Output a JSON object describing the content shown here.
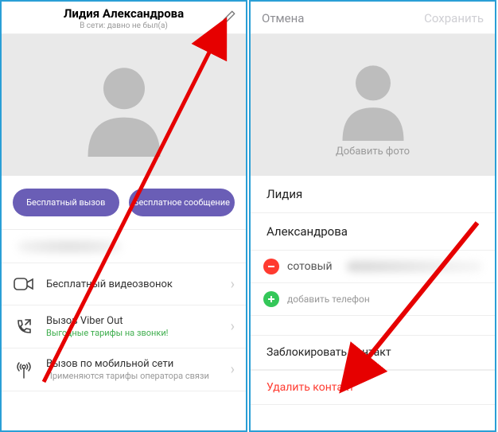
{
  "left": {
    "title": "Лидия Александрова",
    "subtitle": "В сети: давно не был(а)",
    "free_call": "Бесплатный вызов",
    "free_msg": "Бесплатное сообщение",
    "item_video": "Бесплатный видеозвонок",
    "item_viberout": "Вызов Viber Out",
    "item_viberout_sub": "Выгодные тарифы на звонки!",
    "item_cell": "Вызов по мобильной сети",
    "item_cell_sub": "Применяются тарифы оператора связи"
  },
  "right": {
    "cancel": "Отмена",
    "save": "Сохранить",
    "add_photo": "Добавить фото",
    "first_name": "Лидия",
    "last_name": "Александрова",
    "mobile": "сотовый",
    "add_phone": "добавить телефон",
    "block": "Заблокировать контакт",
    "delete": "Удалить контакт"
  }
}
